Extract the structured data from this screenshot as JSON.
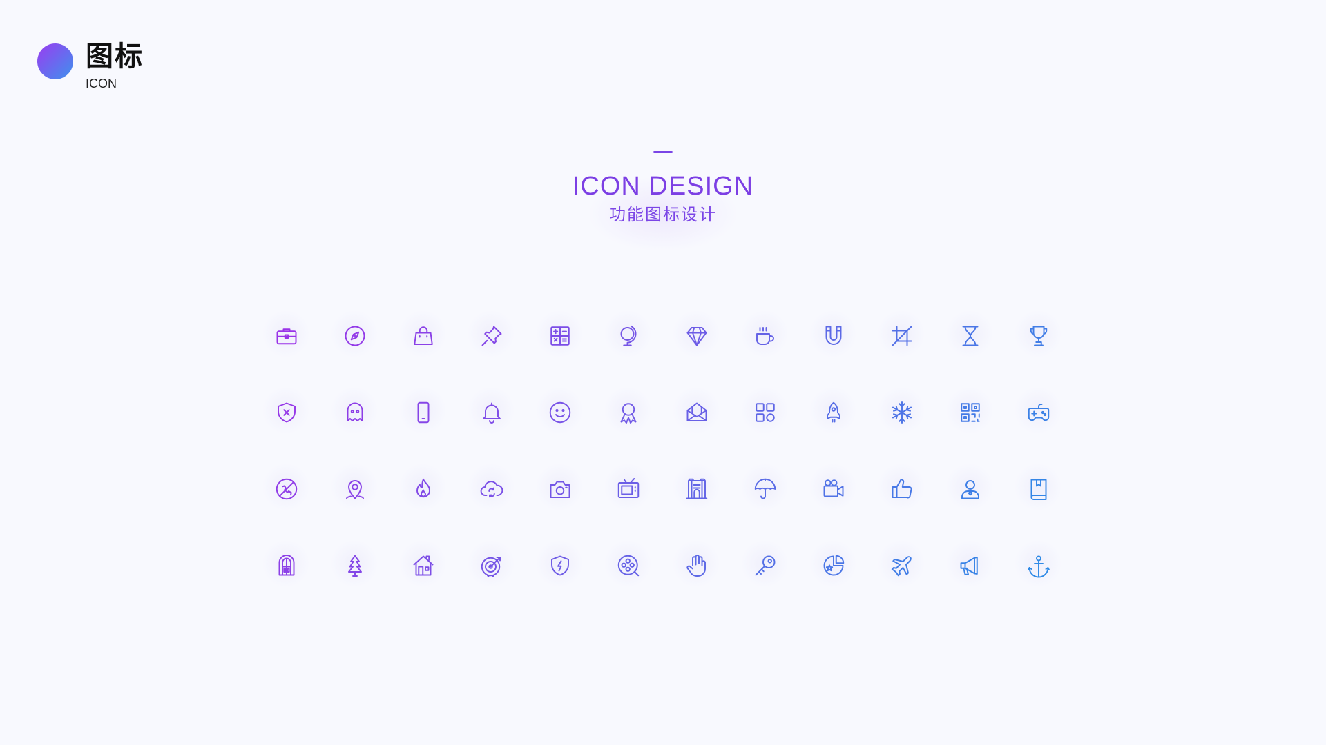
{
  "brand": {
    "title": "图标",
    "subtitle": "ICON"
  },
  "hero": {
    "title": "ICON DESIGN",
    "subtitle": "功能图标设计"
  },
  "colors": {
    "purple": "#9a33e8",
    "mid": "#6a5fe6",
    "blue": "#2f8ae6",
    "background": "#f8f9fe"
  },
  "icons": [
    [
      "briefcase-icon",
      "compass-icon",
      "handbag-icon",
      "pin-icon",
      "calculator-icon",
      "globe-icon",
      "diamond-icon",
      "coffee-cup-icon",
      "magnet-icon",
      "crop-icon",
      "hourglass-icon",
      "trophy-icon"
    ],
    [
      "shield-x-icon",
      "ghost-icon",
      "smartphone-icon",
      "bell-icon",
      "smiley-icon",
      "award-ribbon-icon",
      "open-envelope-icon",
      "app-grid-icon",
      "rocket-icon",
      "snowflake-icon",
      "qr-code-icon",
      "gamepad-icon"
    ],
    [
      "no-phone-icon",
      "location-pin-icon",
      "flame-icon",
      "cloud-sync-icon",
      "camera-icon",
      "tv-icon",
      "gate-icon",
      "umbrella-icon",
      "video-camera-icon",
      "thumbs-up-icon",
      "user-icon",
      "book-icon"
    ],
    [
      "arched-door-icon",
      "pine-tree-icon",
      "house-icon",
      "target-arrow-icon",
      "shield-lightning-icon",
      "film-reel-icon",
      "hand-icon",
      "key-icon",
      "pie-star-icon",
      "airplane-icon",
      "megaphone-icon",
      "anchor-icon"
    ]
  ]
}
